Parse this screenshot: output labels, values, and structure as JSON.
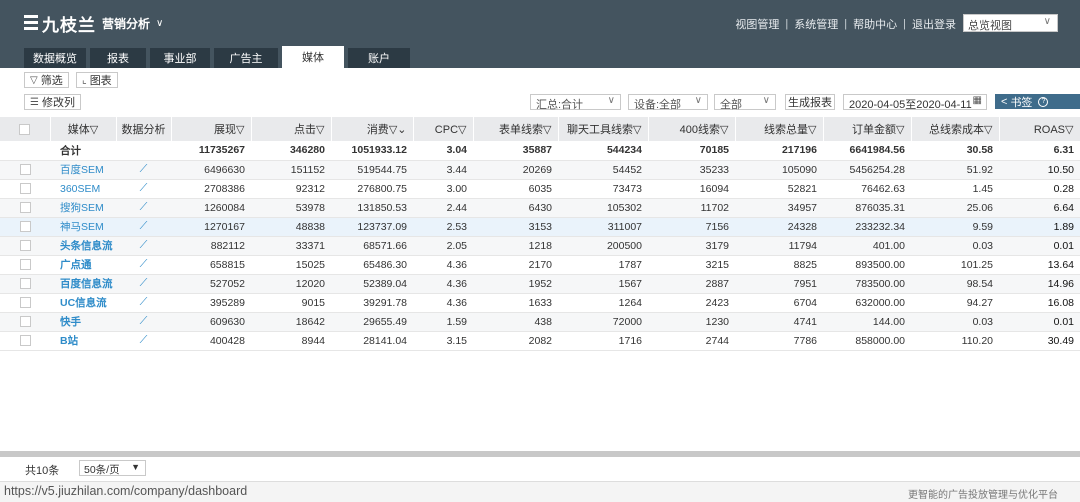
{
  "header": {
    "logo_text": "九枝兰",
    "app_switch": "营销分析",
    "links": [
      "视图管理",
      "系统管理",
      "帮助中心",
      "退出登录"
    ],
    "view_select": "总览视图"
  },
  "tabs": [
    {
      "label": "数据概览",
      "active": false
    },
    {
      "label": "报表",
      "active": false
    },
    {
      "label": "事业部",
      "active": false
    },
    {
      "label": "广告主",
      "active": false
    },
    {
      "label": "媒体",
      "active": true
    },
    {
      "label": "账户",
      "active": false
    }
  ],
  "toolbar": {
    "filter_label": "筛选",
    "chart_label": "图表",
    "modify_columns_label": "修改列",
    "summary_select": "汇总:合计",
    "device_select": "设备:全部",
    "all_select": "全部",
    "generate_report_label": "生成报表",
    "date_range": "2020-04-05至2020-04-11",
    "bookmark_label": "书签"
  },
  "table": {
    "headers": [
      "媒体",
      "数据分析",
      "展现",
      "点击",
      "消费",
      "CPC",
      "表单线索",
      "聊天工具线索",
      "400线索",
      "线索总量",
      "订单金额",
      "总线索成本",
      "ROAS"
    ],
    "total": {
      "label": "合计",
      "values": [
        "11735267",
        "346280",
        "1051933.12",
        "3.04",
        "35887",
        "544234",
        "70185",
        "217196",
        "6641984.56",
        "30.58",
        "6.31"
      ]
    },
    "rows": [
      {
        "name": "百度SEM",
        "values": [
          "6496630",
          "151152",
          "519544.75",
          "3.44",
          "20269",
          "54452",
          "35233",
          "105090",
          "5456254.28",
          "51.92",
          "10.50"
        ]
      },
      {
        "name": "360SEM",
        "values": [
          "2708386",
          "92312",
          "276800.75",
          "3.00",
          "6035",
          "73473",
          "16094",
          "52821",
          "76462.63",
          "1.45",
          "0.28"
        ]
      },
      {
        "name": "搜狗SEM",
        "values": [
          "1260084",
          "53978",
          "131850.53",
          "2.44",
          "6430",
          "105302",
          "11702",
          "34957",
          "876035.31",
          "25.06",
          "6.64"
        ]
      },
      {
        "name": "神马SEM",
        "values": [
          "1270167",
          "48838",
          "123737.09",
          "2.53",
          "3153",
          "311007",
          "7156",
          "24328",
          "233232.34",
          "9.59",
          "1.89"
        ]
      },
      {
        "name": "头条信息流",
        "values": [
          "882112",
          "33371",
          "68571.66",
          "2.05",
          "1218",
          "200500",
          "3179",
          "11794",
          "401.00",
          "0.03",
          "0.01"
        ]
      },
      {
        "name": "广点通",
        "values": [
          "658815",
          "15025",
          "65486.30",
          "4.36",
          "2170",
          "1787",
          "3215",
          "8825",
          "893500.00",
          "101.25",
          "13.64"
        ]
      },
      {
        "name": "百度信息流",
        "values": [
          "527052",
          "12020",
          "52389.04",
          "4.36",
          "1952",
          "1567",
          "2887",
          "7951",
          "783500.00",
          "98.54",
          "14.96"
        ]
      },
      {
        "name": "UC信息流",
        "values": [
          "395289",
          "9015",
          "39291.78",
          "4.36",
          "1633",
          "1264",
          "2423",
          "6704",
          "632000.00",
          "94.27",
          "16.08"
        ]
      },
      {
        "name": "快手",
        "values": [
          "609630",
          "18642",
          "29655.49",
          "1.59",
          "438",
          "72000",
          "1230",
          "4741",
          "144.00",
          "0.03",
          "0.01"
        ]
      },
      {
        "name": "B站",
        "values": [
          "400428",
          "8944",
          "28141.04",
          "3.15",
          "2082",
          "1716",
          "2744",
          "7786",
          "858000.00",
          "110.20",
          "30.49"
        ]
      }
    ]
  },
  "pager": {
    "total_label": "共10条",
    "page_size": "50条/页"
  },
  "status": {
    "url": "https://v5.jiuzhilan.com/company/dashboard",
    "slogan": "更智能的广告投放管理与优化平台"
  }
}
